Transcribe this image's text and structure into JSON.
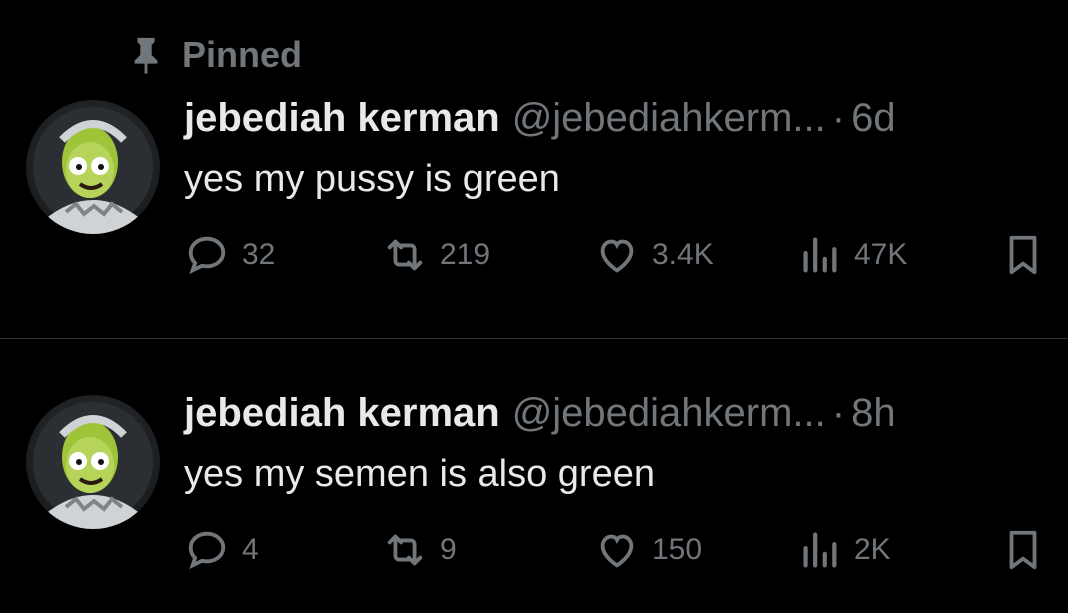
{
  "pinned_label": "Pinned",
  "tweets": [
    {
      "name": "jebediah kerman",
      "handle": "@jebediahkerm...",
      "separator": "·",
      "time": "6d",
      "text": "yes my pussy is green",
      "stats": {
        "replies": "32",
        "retweets": "219",
        "likes": "3.4K",
        "views": "47K"
      }
    },
    {
      "name": "jebediah kerman",
      "handle": "@jebediahkerm...",
      "separator": "·",
      "time": "8h",
      "text": "yes my semen is also green",
      "stats": {
        "replies": "4",
        "retweets": "9",
        "likes": "150",
        "views": "2K"
      }
    }
  ],
  "icons": {
    "pin": "pin-icon",
    "reply": "reply-icon",
    "retweet": "retweet-icon",
    "like": "heart-icon",
    "views": "views-icon",
    "bookmark": "bookmark-icon"
  },
  "colors": {
    "background": "#000000",
    "primary_text": "#e7e9ea",
    "secondary_text": "#71767b",
    "divider": "#2f3336",
    "avatar_skin": "#9fc43a"
  }
}
